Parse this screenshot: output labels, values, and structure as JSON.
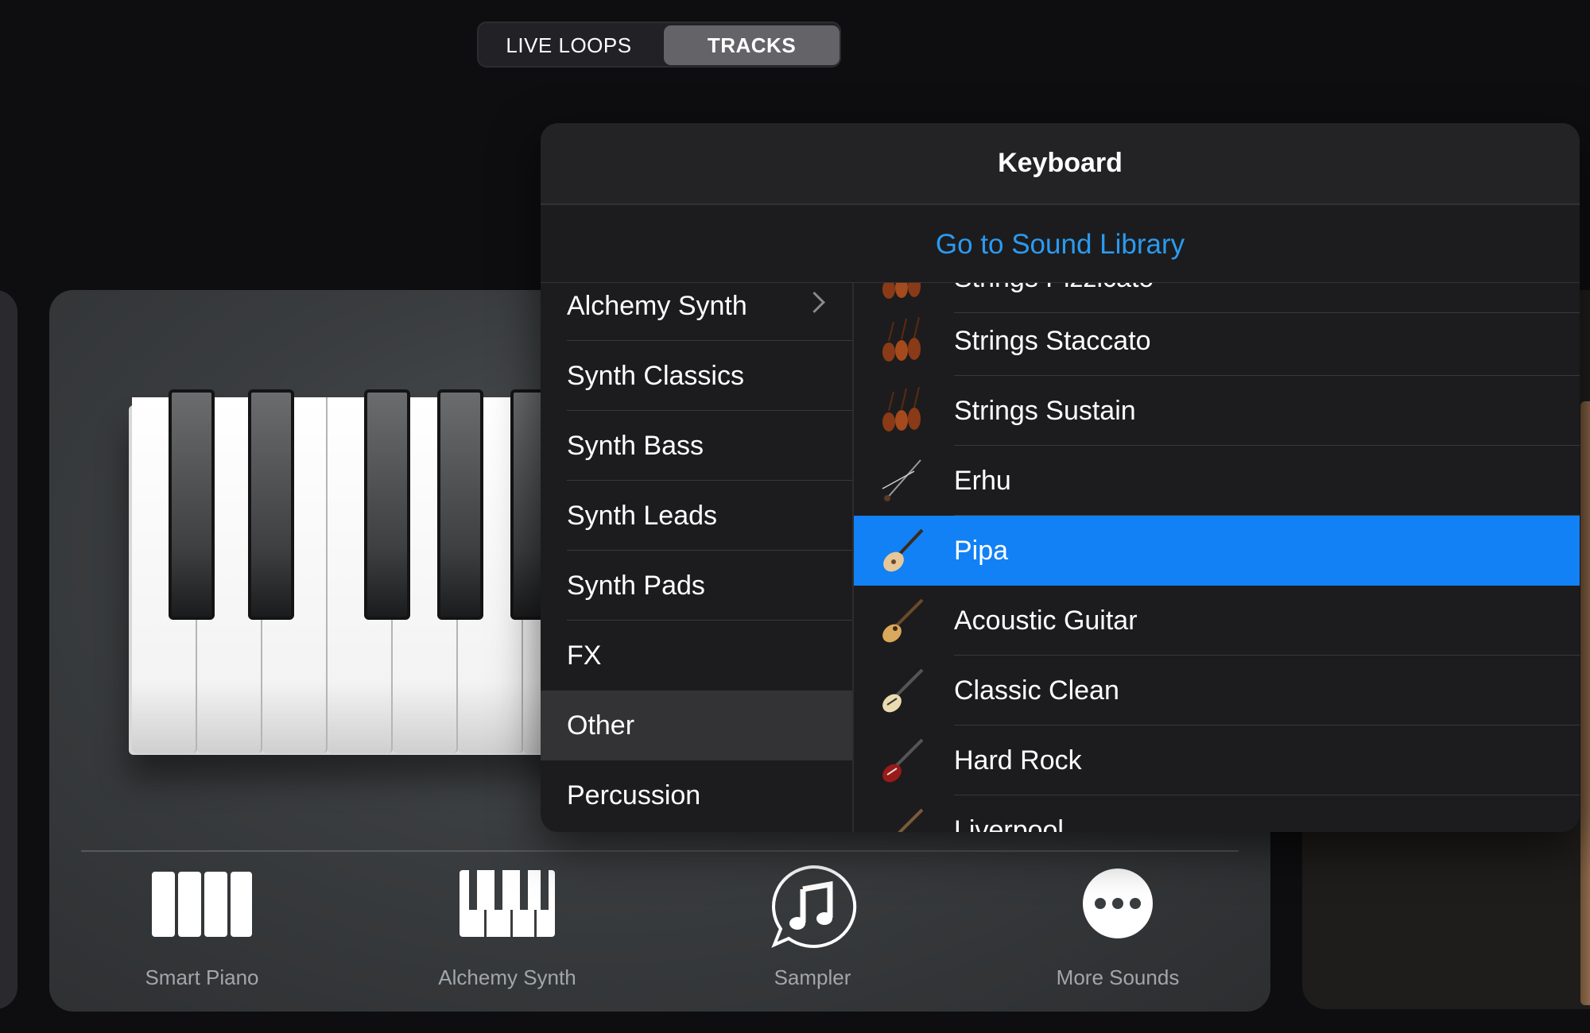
{
  "segmented": {
    "left_label": "LIVE LOOPS",
    "right_label": "TRACKS",
    "selected": "TRACKS"
  },
  "popover": {
    "title": "Keyboard",
    "library_link": "Go to Sound Library",
    "categories": [
      {
        "label": "Alchemy Synth",
        "has_chevron": true
      },
      {
        "label": "Synth Classics"
      },
      {
        "label": "Synth Bass"
      },
      {
        "label": "Synth Leads"
      },
      {
        "label": "Synth Pads"
      },
      {
        "label": "FX"
      },
      {
        "label": "Other",
        "selected": true
      },
      {
        "label": "Percussion"
      }
    ],
    "sounds": [
      {
        "label": "Strings Pizzicato",
        "icon": "strings-section-icon"
      },
      {
        "label": "Strings Staccato",
        "icon": "strings-section-icon"
      },
      {
        "label": "Strings Sustain",
        "icon": "strings-section-icon"
      },
      {
        "label": "Erhu",
        "icon": "erhu-icon"
      },
      {
        "label": "Pipa",
        "icon": "pipa-icon",
        "selected": true
      },
      {
        "label": "Acoustic Guitar",
        "icon": "acoustic-guitar-icon"
      },
      {
        "label": "Classic Clean",
        "icon": "hollow-body-guitar-icon"
      },
      {
        "label": "Hard Rock",
        "icon": "electric-guitar-icon"
      },
      {
        "label": "Liverpool",
        "icon": "bass-guitar-icon"
      }
    ]
  },
  "bottom_sounds": [
    {
      "label": "Smart Piano",
      "icon": "smart-piano-icon"
    },
    {
      "label": "Alchemy Synth",
      "icon": "alchemy-synth-icon"
    },
    {
      "label": "Sampler",
      "icon": "sampler-icon"
    },
    {
      "label": "More Sounds",
      "icon": "more-sounds-icon"
    }
  ],
  "colors": {
    "accent": "#1181f5",
    "link": "#2c9af0",
    "background": "#0e0e10"
  }
}
